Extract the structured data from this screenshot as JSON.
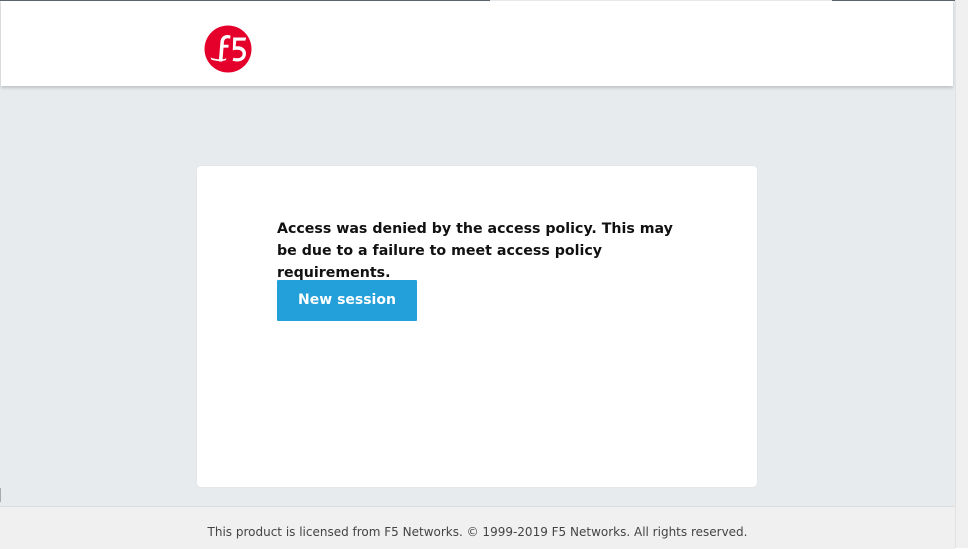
{
  "header": {
    "logo_text": "f5",
    "brand_color": "#e4002b"
  },
  "card": {
    "message": "Access was denied by the access policy. This may be due to a failure to meet access policy requirements.",
    "new_session_label": "New session",
    "button_color": "#23a0d9"
  },
  "footer": {
    "copyright": "This product is licensed from F5 Networks. © 1999-2019 F5 Networks. All rights reserved."
  }
}
